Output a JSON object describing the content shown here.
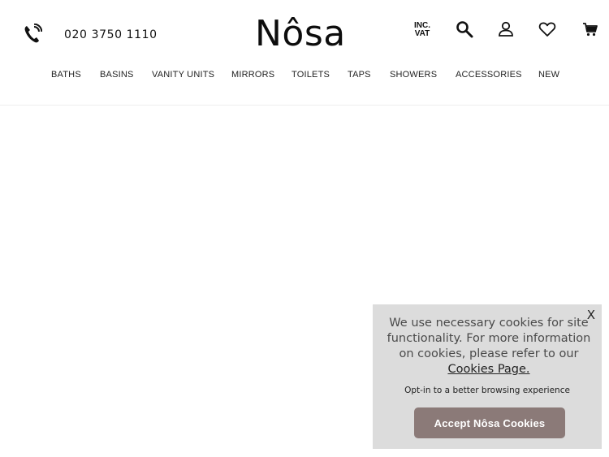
{
  "header": {
    "phone": "020 3750 1110",
    "logo": "Nôsa",
    "vat_toggle": {
      "line1": "INC.",
      "line2": "VAT"
    },
    "icons": [
      "phone-icon",
      "search-icon",
      "account-icon",
      "heart-icon",
      "basket-icon"
    ]
  },
  "nav": {
    "items": [
      {
        "label": "BATHS"
      },
      {
        "label": "BASINS"
      },
      {
        "label": "VANITY UNITS"
      },
      {
        "label": "MIRRORS"
      },
      {
        "label": "TOILETS"
      },
      {
        "label": "TAPS"
      },
      {
        "label": "SHOWERS"
      },
      {
        "label": "ACCESSORIES"
      },
      {
        "label": "NEW"
      }
    ]
  },
  "cookie": {
    "close": "X",
    "text": "We use necessary cookies for site functionality. For more information on cookies, please refer to our",
    "link": "Cookies Page.",
    "optin": "Opt-in to a better browsing experience",
    "accept": "Accept Nôsa Cookies"
  },
  "colors": {
    "accent_button": "#8b7a78",
    "cookie_panel": "#dcdcdc",
    "text_dark": "#111111"
  }
}
